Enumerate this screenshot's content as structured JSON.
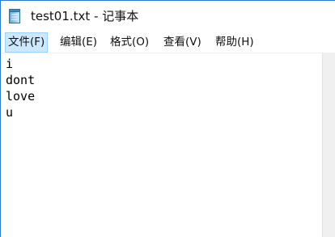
{
  "window": {
    "title": "test01.txt - 记事本",
    "app_icon": "notepad-icon"
  },
  "menu": {
    "items": [
      {
        "label": "文件(F)",
        "active": true
      },
      {
        "label": "编辑(E)",
        "active": false
      },
      {
        "label": "格式(O)",
        "active": false
      },
      {
        "label": "查看(V)",
        "active": false
      },
      {
        "label": "帮助(H)",
        "active": false
      }
    ]
  },
  "editor": {
    "lines": [
      "i",
      "dont",
      "love",
      "u"
    ]
  },
  "colors": {
    "window_border": "#2b78d4",
    "menu_active_background": "#cce8ff",
    "menu_active_border": "#99d1ff",
    "scrollbar_track": "#f0f0f0"
  }
}
